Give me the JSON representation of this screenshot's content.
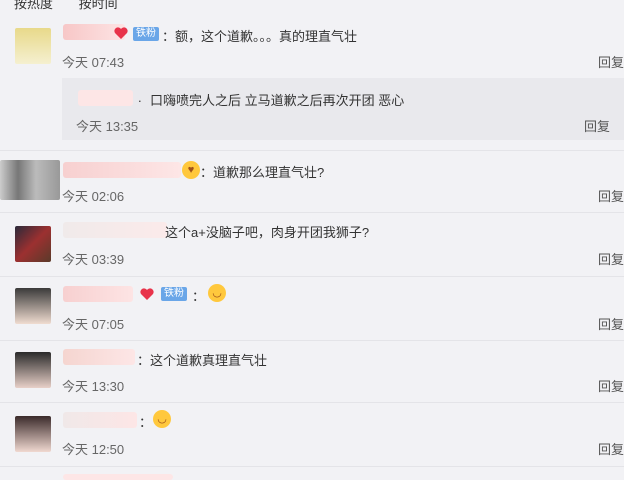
{
  "sort_tabs": [
    "按热度",
    "按时间"
  ],
  "badge_label": "铁粉",
  "reply_label": "回复",
  "comments": [
    {
      "text": "：额，这个道歉。。。真的理直气壮",
      "time": "今天 07:43"
    },
    {
      "text": "口嗨喷完人之后 立马道歉之后再次开团  恶心",
      "time": "今天 13:35",
      "sub": true
    },
    {
      "text": "：道歉那么理直气壮?",
      "time": "今天 02:06"
    },
    {
      "text": "这个a+没脑子吧，肉身开团我狮子?",
      "time": "今天 03:39"
    },
    {
      "text": "：",
      "time": "今天 07:05"
    },
    {
      "text": "：这个道歉真理直气壮",
      "time": "今天 13:30"
    },
    {
      "text": "：",
      "time": "今天 12:50"
    }
  ],
  "colors": {
    "badge": "#6aa6e8",
    "emoji": "#ffc83d",
    "heart": "#e8334a",
    "text": "#333333",
    "meta": "#666666"
  },
  "icons": [
    "avatar",
    "heart-icon",
    "vip-badge",
    "smile-emoji"
  ]
}
